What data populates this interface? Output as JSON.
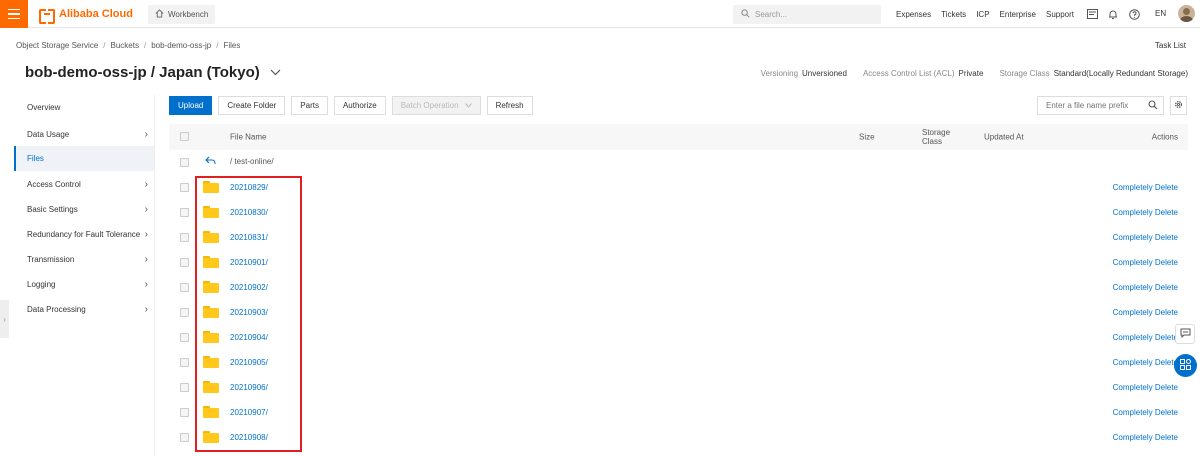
{
  "topbar": {
    "brand": "Alibaba Cloud",
    "workbench": "Workbench",
    "search_placeholder": "Search...",
    "nav": [
      "Expenses",
      "Tickets",
      "ICP",
      "Enterprise",
      "Support"
    ],
    "lang": "EN"
  },
  "breadcrumb": [
    "Object Storage Service",
    "Buckets",
    "bob-demo-oss-jp",
    "Files"
  ],
  "task_list": "Task List",
  "title": "bob-demo-oss-jp / Japan (Tokyo)",
  "meta": {
    "versioning_label": "Versioning",
    "versioning_value": "Unversioned",
    "acl_label": "Access Control List (ACL)",
    "acl_value": "Private",
    "storage_label": "Storage Class",
    "storage_value": "Standard(Locally Redundant Storage)"
  },
  "sidebar": [
    {
      "label": "Overview",
      "arrow": false,
      "active": false
    },
    {
      "label": "Data Usage",
      "arrow": true,
      "active": false
    },
    {
      "label": "Files",
      "arrow": false,
      "active": true
    },
    {
      "label": "Access Control",
      "arrow": true,
      "active": false
    },
    {
      "label": "Basic Settings",
      "arrow": true,
      "active": false
    },
    {
      "label": "Redundancy for Fault Tolerance",
      "arrow": true,
      "active": false
    },
    {
      "label": "Transmission",
      "arrow": true,
      "active": false
    },
    {
      "label": "Logging",
      "arrow": true,
      "active": false
    },
    {
      "label": "Data Processing",
      "arrow": true,
      "active": false
    }
  ],
  "toolbar": {
    "upload": "Upload",
    "create_folder": "Create Folder",
    "parts": "Parts",
    "authorize": "Authorize",
    "batch_operation": "Batch Operation",
    "refresh": "Refresh",
    "file_prefix_placeholder": "Enter a file name prefix"
  },
  "table": {
    "headers": {
      "file_name": "File Name",
      "size": "Size",
      "storage_class_1": "Storage",
      "storage_class_2": "Class",
      "updated_at": "Updated At",
      "actions": "Actions"
    },
    "parent_path": "/ test-online/",
    "rows": [
      "20210829/",
      "20210830/",
      "20210831/",
      "20210901/",
      "20210902/",
      "20210903/",
      "20210904/",
      "20210905/",
      "20210906/",
      "20210907/",
      "20210908/"
    ],
    "row_action": "Completely Delete"
  },
  "colors": {
    "brand_orange": "#ff6a00",
    "primary_blue": "#0070cc",
    "highlight_red": "#e02020",
    "folder_yellow": "#ffc81a"
  }
}
